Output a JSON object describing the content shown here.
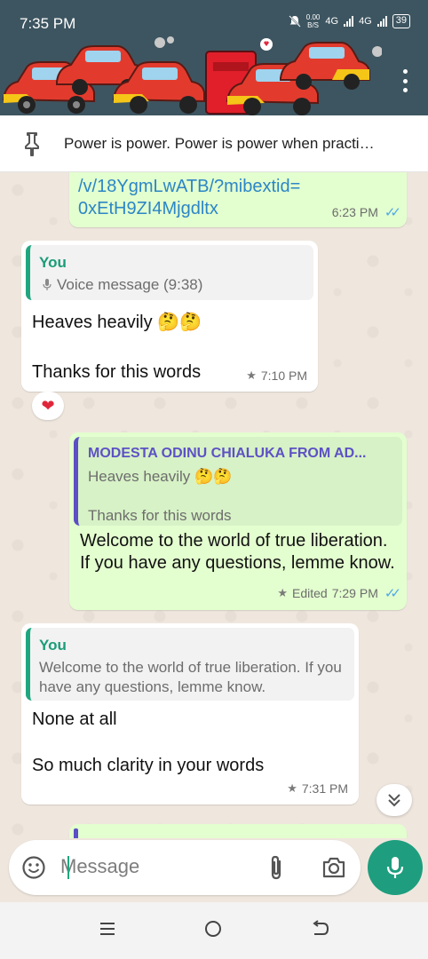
{
  "status_bar": {
    "time": "7:35 PM",
    "net_speed_value": "0.00",
    "net_speed_unit": "B/S",
    "network_1": "4G",
    "network_2": "4G",
    "battery": "39"
  },
  "pinned": {
    "text": "Power is power. Power is power when practi…"
  },
  "messages": {
    "m1": {
      "link_line1": "/v/18YgmLwATB/?mibextid=",
      "link_line2": "0xEtH9ZI4Mjgdltx",
      "time": "6:23 PM"
    },
    "m2": {
      "quote_author": "You",
      "quote_text": "Voice message (9:38)",
      "line1": "Heaves heavily 🤔🤔",
      "line2": "Thanks for this words",
      "time": "7:10 PM",
      "reaction": "❤"
    },
    "m3": {
      "quote_author": "MODESTA ODINU CHIALUKA FROM AD...",
      "quote_line1": "Heaves heavily 🤔🤔",
      "quote_line2": "Thanks for this words",
      "text": "Welcome to the world of true liberation. If you have any questions, lemme know.",
      "edited": "Edited",
      "time": "7:29 PM"
    },
    "m4": {
      "quote_author": "You",
      "quote_text": "Welcome to the world of true liberation. If you have any questions, lemme know.",
      "line1": "None at all",
      "line2": "So much clarity in your words",
      "time": "7:31 PM"
    }
  },
  "composer": {
    "placeholder": "Message"
  },
  "colors": {
    "header": "#3d5560",
    "accent": "#1e9e7e",
    "outgoing_bubble": "#e3fecf",
    "read_ticks": "#4fa8e8"
  },
  "icons": [
    "pin-icon",
    "emoji-icon",
    "attach-icon",
    "camera-icon",
    "mic-icon",
    "more-vert-icon",
    "double-chevron-down-icon",
    "recent-apps-icon",
    "home-icon",
    "back-icon"
  ]
}
